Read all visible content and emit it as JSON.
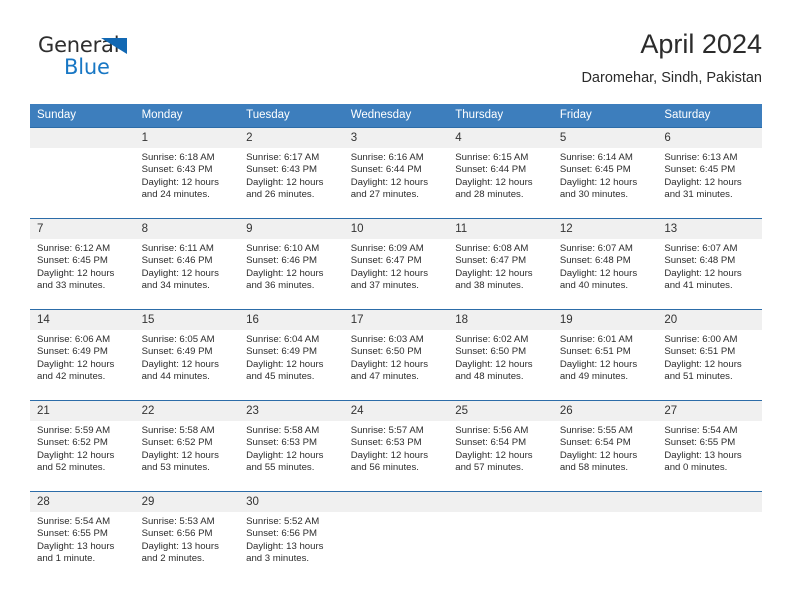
{
  "brand": {
    "name_part1": "General",
    "name_part2": "Blue",
    "accent_color": "#1877c4",
    "triangle_color": "#1268b3"
  },
  "header": {
    "title": "April 2024",
    "subtitle": "Daromehar, Sindh, Pakistan"
  },
  "theme": {
    "header_row_bg": "#3d7ebd",
    "week_border": "#2c6ca8",
    "daynum_bg": "#f0f0f0"
  },
  "weekdays": [
    "Sunday",
    "Monday",
    "Tuesday",
    "Wednesday",
    "Thursday",
    "Friday",
    "Saturday"
  ],
  "weeks": [
    [
      {
        "day": "",
        "blank": true,
        "sunrise": "",
        "sunset": "",
        "daylight_line1": "",
        "daylight_line2": ""
      },
      {
        "day": "1",
        "blank": false,
        "sunrise": "Sunrise: 6:18 AM",
        "sunset": "Sunset: 6:43 PM",
        "daylight_line1": "Daylight: 12 hours",
        "daylight_line2": "and 24 minutes."
      },
      {
        "day": "2",
        "blank": false,
        "sunrise": "Sunrise: 6:17 AM",
        "sunset": "Sunset: 6:43 PM",
        "daylight_line1": "Daylight: 12 hours",
        "daylight_line2": "and 26 minutes."
      },
      {
        "day": "3",
        "blank": false,
        "sunrise": "Sunrise: 6:16 AM",
        "sunset": "Sunset: 6:44 PM",
        "daylight_line1": "Daylight: 12 hours",
        "daylight_line2": "and 27 minutes."
      },
      {
        "day": "4",
        "blank": false,
        "sunrise": "Sunrise: 6:15 AM",
        "sunset": "Sunset: 6:44 PM",
        "daylight_line1": "Daylight: 12 hours",
        "daylight_line2": "and 28 minutes."
      },
      {
        "day": "5",
        "blank": false,
        "sunrise": "Sunrise: 6:14 AM",
        "sunset": "Sunset: 6:45 PM",
        "daylight_line1": "Daylight: 12 hours",
        "daylight_line2": "and 30 minutes."
      },
      {
        "day": "6",
        "blank": false,
        "sunrise": "Sunrise: 6:13 AM",
        "sunset": "Sunset: 6:45 PM",
        "daylight_line1": "Daylight: 12 hours",
        "daylight_line2": "and 31 minutes."
      }
    ],
    [
      {
        "day": "7",
        "blank": false,
        "sunrise": "Sunrise: 6:12 AM",
        "sunset": "Sunset: 6:45 PM",
        "daylight_line1": "Daylight: 12 hours",
        "daylight_line2": "and 33 minutes."
      },
      {
        "day": "8",
        "blank": false,
        "sunrise": "Sunrise: 6:11 AM",
        "sunset": "Sunset: 6:46 PM",
        "daylight_line1": "Daylight: 12 hours",
        "daylight_line2": "and 34 minutes."
      },
      {
        "day": "9",
        "blank": false,
        "sunrise": "Sunrise: 6:10 AM",
        "sunset": "Sunset: 6:46 PM",
        "daylight_line1": "Daylight: 12 hours",
        "daylight_line2": "and 36 minutes."
      },
      {
        "day": "10",
        "blank": false,
        "sunrise": "Sunrise: 6:09 AM",
        "sunset": "Sunset: 6:47 PM",
        "daylight_line1": "Daylight: 12 hours",
        "daylight_line2": "and 37 minutes."
      },
      {
        "day": "11",
        "blank": false,
        "sunrise": "Sunrise: 6:08 AM",
        "sunset": "Sunset: 6:47 PM",
        "daylight_line1": "Daylight: 12 hours",
        "daylight_line2": "and 38 minutes."
      },
      {
        "day": "12",
        "blank": false,
        "sunrise": "Sunrise: 6:07 AM",
        "sunset": "Sunset: 6:48 PM",
        "daylight_line1": "Daylight: 12 hours",
        "daylight_line2": "and 40 minutes."
      },
      {
        "day": "13",
        "blank": false,
        "sunrise": "Sunrise: 6:07 AM",
        "sunset": "Sunset: 6:48 PM",
        "daylight_line1": "Daylight: 12 hours",
        "daylight_line2": "and 41 minutes."
      }
    ],
    [
      {
        "day": "14",
        "blank": false,
        "sunrise": "Sunrise: 6:06 AM",
        "sunset": "Sunset: 6:49 PM",
        "daylight_line1": "Daylight: 12 hours",
        "daylight_line2": "and 42 minutes."
      },
      {
        "day": "15",
        "blank": false,
        "sunrise": "Sunrise: 6:05 AM",
        "sunset": "Sunset: 6:49 PM",
        "daylight_line1": "Daylight: 12 hours",
        "daylight_line2": "and 44 minutes."
      },
      {
        "day": "16",
        "blank": false,
        "sunrise": "Sunrise: 6:04 AM",
        "sunset": "Sunset: 6:49 PM",
        "daylight_line1": "Daylight: 12 hours",
        "daylight_line2": "and 45 minutes."
      },
      {
        "day": "17",
        "blank": false,
        "sunrise": "Sunrise: 6:03 AM",
        "sunset": "Sunset: 6:50 PM",
        "daylight_line1": "Daylight: 12 hours",
        "daylight_line2": "and 47 minutes."
      },
      {
        "day": "18",
        "blank": false,
        "sunrise": "Sunrise: 6:02 AM",
        "sunset": "Sunset: 6:50 PM",
        "daylight_line1": "Daylight: 12 hours",
        "daylight_line2": "and 48 minutes."
      },
      {
        "day": "19",
        "blank": false,
        "sunrise": "Sunrise: 6:01 AM",
        "sunset": "Sunset: 6:51 PM",
        "daylight_line1": "Daylight: 12 hours",
        "daylight_line2": "and 49 minutes."
      },
      {
        "day": "20",
        "blank": false,
        "sunrise": "Sunrise: 6:00 AM",
        "sunset": "Sunset: 6:51 PM",
        "daylight_line1": "Daylight: 12 hours",
        "daylight_line2": "and 51 minutes."
      }
    ],
    [
      {
        "day": "21",
        "blank": false,
        "sunrise": "Sunrise: 5:59 AM",
        "sunset": "Sunset: 6:52 PM",
        "daylight_line1": "Daylight: 12 hours",
        "daylight_line2": "and 52 minutes."
      },
      {
        "day": "22",
        "blank": false,
        "sunrise": "Sunrise: 5:58 AM",
        "sunset": "Sunset: 6:52 PM",
        "daylight_line1": "Daylight: 12 hours",
        "daylight_line2": "and 53 minutes."
      },
      {
        "day": "23",
        "blank": false,
        "sunrise": "Sunrise: 5:58 AM",
        "sunset": "Sunset: 6:53 PM",
        "daylight_line1": "Daylight: 12 hours",
        "daylight_line2": "and 55 minutes."
      },
      {
        "day": "24",
        "blank": false,
        "sunrise": "Sunrise: 5:57 AM",
        "sunset": "Sunset: 6:53 PM",
        "daylight_line1": "Daylight: 12 hours",
        "daylight_line2": "and 56 minutes."
      },
      {
        "day": "25",
        "blank": false,
        "sunrise": "Sunrise: 5:56 AM",
        "sunset": "Sunset: 6:54 PM",
        "daylight_line1": "Daylight: 12 hours",
        "daylight_line2": "and 57 minutes."
      },
      {
        "day": "26",
        "blank": false,
        "sunrise": "Sunrise: 5:55 AM",
        "sunset": "Sunset: 6:54 PM",
        "daylight_line1": "Daylight: 12 hours",
        "daylight_line2": "and 58 minutes."
      },
      {
        "day": "27",
        "blank": false,
        "sunrise": "Sunrise: 5:54 AM",
        "sunset": "Sunset: 6:55 PM",
        "daylight_line1": "Daylight: 13 hours",
        "daylight_line2": "and 0 minutes."
      }
    ],
    [
      {
        "day": "28",
        "blank": false,
        "sunrise": "Sunrise: 5:54 AM",
        "sunset": "Sunset: 6:55 PM",
        "daylight_line1": "Daylight: 13 hours",
        "daylight_line2": "and 1 minute."
      },
      {
        "day": "29",
        "blank": false,
        "sunrise": "Sunrise: 5:53 AM",
        "sunset": "Sunset: 6:56 PM",
        "daylight_line1": "Daylight: 13 hours",
        "daylight_line2": "and 2 minutes."
      },
      {
        "day": "30",
        "blank": false,
        "sunrise": "Sunrise: 5:52 AM",
        "sunset": "Sunset: 6:56 PM",
        "daylight_line1": "Daylight: 13 hours",
        "daylight_line2": "and 3 minutes."
      },
      {
        "day": "",
        "blank": true,
        "sunrise": "",
        "sunset": "",
        "daylight_line1": "",
        "daylight_line2": ""
      },
      {
        "day": "",
        "blank": true,
        "sunrise": "",
        "sunset": "",
        "daylight_line1": "",
        "daylight_line2": ""
      },
      {
        "day": "",
        "blank": true,
        "sunrise": "",
        "sunset": "",
        "daylight_line1": "",
        "daylight_line2": ""
      },
      {
        "day": "",
        "blank": true,
        "sunrise": "",
        "sunset": "",
        "daylight_line1": "",
        "daylight_line2": ""
      }
    ]
  ]
}
